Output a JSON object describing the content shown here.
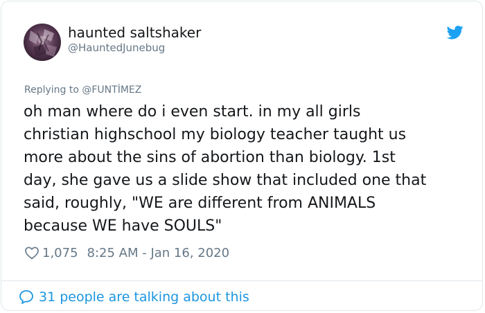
{
  "author": {
    "display_name": "haunted saltshaker",
    "handle": "@HauntedJunebug"
  },
  "reply": {
    "text": "Replying to @FUNTİMEZ"
  },
  "tweet": {
    "text": "oh man where do i even start. in my all girls\nchristian highschool my biology teacher taught us\nmore about the sins of abortion than biology. 1st\nday, she gave us a slide show that included one that\nsaid, roughly, \"WE are different from ANIMALS\nbecause WE have SOULS\""
  },
  "meta": {
    "likes": "1,075",
    "timestamp": "8:25 AM - Jan 16, 2020"
  },
  "footer": {
    "talking_text": "31 people are talking about this"
  },
  "icons": {
    "logo": "twitter-bird-icon",
    "like": "heart-outline-icon",
    "talking": "speech-bubble-icon"
  },
  "colors": {
    "brand_blue": "#1da1f2",
    "link_blue": "#1b95e0",
    "secondary_text": "#657786",
    "primary_text": "#14171a",
    "border": "#e1e8ed"
  }
}
